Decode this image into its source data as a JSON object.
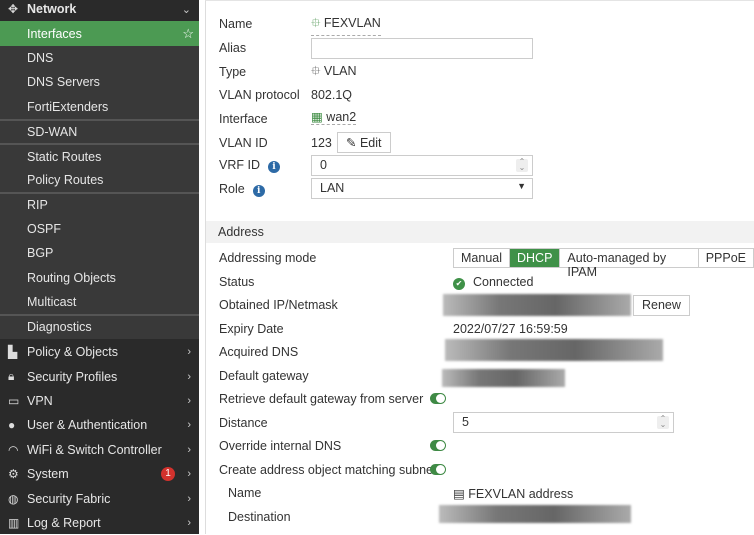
{
  "sidebar": {
    "network": "Network",
    "sub": [
      "Interfaces",
      "DNS",
      "DNS Servers",
      "FortiExtenders",
      "SD-WAN",
      "Static Routes",
      "Policy Routes",
      "RIP",
      "OSPF",
      "BGP",
      "Routing Objects",
      "Multicast",
      "Diagnostics"
    ],
    "top": [
      "Policy & Objects",
      "Security Profiles",
      "VPN",
      "User & Authentication",
      "WiFi & Switch Controller",
      "System",
      "Security Fabric",
      "Log & Report"
    ],
    "system_badge": "1"
  },
  "form": {
    "name_label": "Name",
    "name_value": "FEXVLAN",
    "alias_label": "Alias",
    "alias_value": "",
    "type_label": "Type",
    "type_value": "VLAN",
    "protocol_label": "VLAN protocol",
    "protocol_value": "802.1Q",
    "interface_label": "Interface",
    "interface_value": "wan2",
    "vlanid_label": "VLAN ID",
    "vlanid_value": "123",
    "edit_label": "Edit",
    "vrf_label": "VRF ID",
    "vrf_value": "0",
    "role_label": "Role",
    "role_value": "LAN"
  },
  "address": {
    "section": "Address",
    "mode_label": "Addressing mode",
    "modes": [
      "Manual",
      "DHCP",
      "Auto-managed by IPAM",
      "PPPoE"
    ],
    "status_label": "Status",
    "status_value": "Connected",
    "ip_label": "Obtained IP/Netmask",
    "renew_label": "Renew",
    "expiry_label": "Expiry Date",
    "expiry_value": "2022/07/27 16:59:59",
    "dns_label": "Acquired DNS",
    "gateway_label": "Default gateway",
    "retrieve_label": "Retrieve default gateway from server",
    "distance_label": "Distance",
    "distance_value": "5",
    "override_label": "Override internal DNS",
    "create_label": "Create address object matching subnet",
    "obj_name_label": "Name",
    "obj_name_value": "FEXVLAN address",
    "destination_label": "Destination"
  },
  "colors": {
    "accent": "#4c9a53",
    "sidebar": "#2a2a2a"
  }
}
